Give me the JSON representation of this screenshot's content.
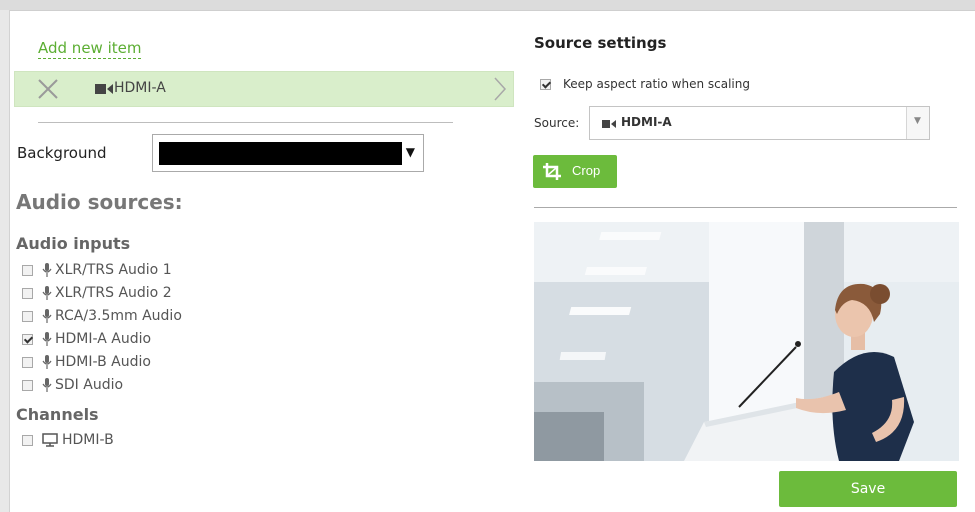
{
  "left_panel": {
    "add_new_item": "Add new item",
    "selected_item": {
      "label": "HDMI-A",
      "icon": "video-camera-icon"
    },
    "background": {
      "label": "Background",
      "value_color": "#000000",
      "arrow": "▼"
    },
    "audio_sources": {
      "title": "Audio sources:",
      "inputs_heading": "Audio inputs",
      "inputs": [
        {
          "label": "XLR/TRS Audio 1",
          "checked": false
        },
        {
          "label": "XLR/TRS Audio 2",
          "checked": false
        },
        {
          "label": "RCA/3.5mm Audio",
          "checked": false
        },
        {
          "label": "HDMI-A Audio",
          "checked": true
        },
        {
          "label": "HDMI-B Audio",
          "checked": false
        },
        {
          "label": "SDI Audio",
          "checked": false
        }
      ],
      "channels_heading": "Channels",
      "channels": [
        {
          "label": "HDMI-B",
          "checked": false
        }
      ]
    }
  },
  "right_panel": {
    "title": "Source settings",
    "keep_aspect": {
      "label": "Keep aspect ratio when scaling",
      "checked": true
    },
    "source": {
      "label": "Source:",
      "value": "HDMI-A",
      "arrow": "▼"
    },
    "crop_button": "Crop",
    "save_button": "Save"
  },
  "colors": {
    "accent_green": "#6cbb3c",
    "link_green": "#5cae33",
    "selected_row": "#d9eecb"
  }
}
